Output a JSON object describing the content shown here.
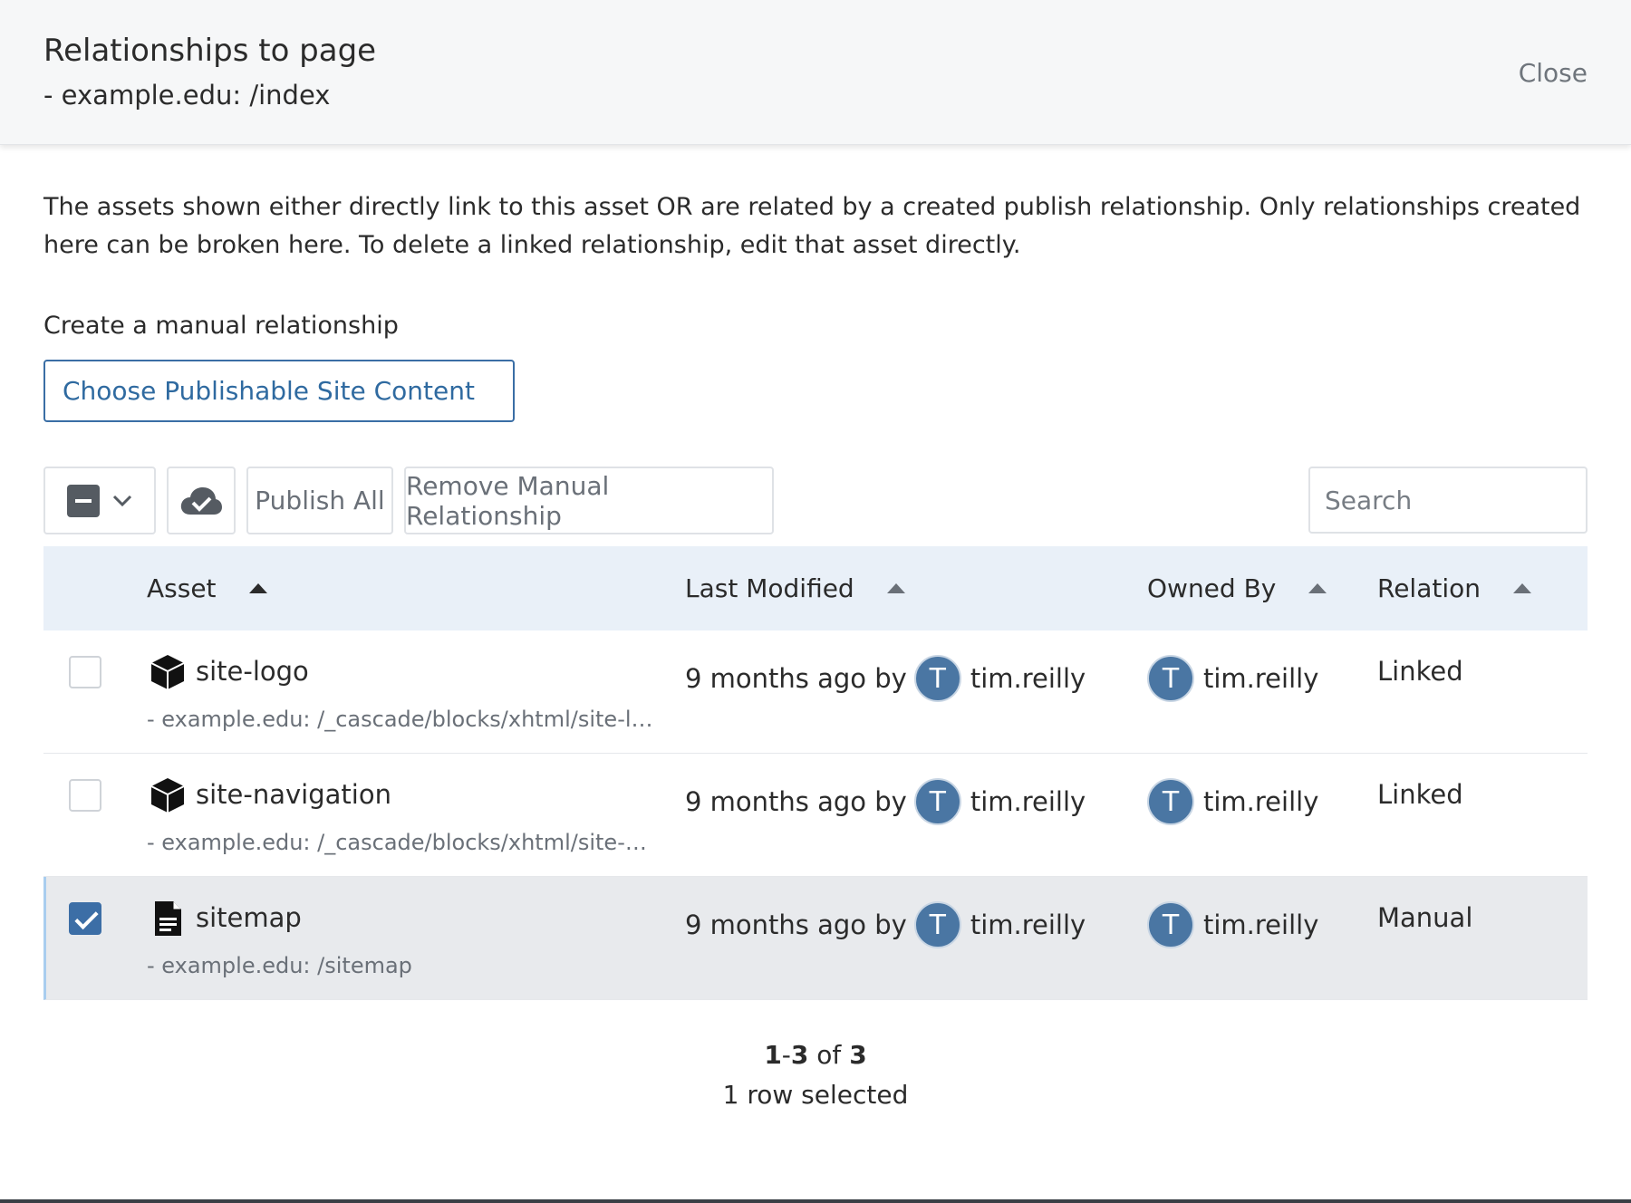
{
  "header": {
    "title": "Relationships to page",
    "subtitle": "- example.edu: /index",
    "close_label": "Close"
  },
  "description": "The assets shown either directly link to this asset OR are related by a created publish relationship. Only relationships created here can be broken here. To delete a linked relationship, edit that asset directly.",
  "manual": {
    "label": "Create a manual relationship",
    "choose_button": "Choose Publishable Site Content"
  },
  "toolbar": {
    "publish_all": "Publish All",
    "remove_manual": "Remove Manual Relationship",
    "search_placeholder": "Search",
    "icons": [
      "minus-checkbox-icon",
      "chevron-down-icon",
      "cloud-check-icon"
    ]
  },
  "table": {
    "columns": [
      "Asset",
      "Last Modified",
      "Owned By",
      "Relation"
    ],
    "rows": [
      {
        "icon": "block-cube-icon",
        "name": "site-logo",
        "path": "- example.edu: /_cascade/blocks/xhtml/site-logo",
        "modified": "9 months ago by",
        "modified_user_initial": "T",
        "modified_user": "tim.reilly",
        "owner_initial": "T",
        "owner": "tim.reilly",
        "relation": "Linked",
        "checked": false
      },
      {
        "icon": "block-cube-icon",
        "name": "site-navigation",
        "path": "- example.edu: /_cascade/blocks/xhtml/site-na...",
        "modified": "9 months ago by",
        "modified_user_initial": "T",
        "modified_user": "tim.reilly",
        "owner_initial": "T",
        "owner": "tim.reilly",
        "relation": "Linked",
        "checked": false
      },
      {
        "icon": "page-document-icon",
        "name": "sitemap",
        "path": "- example.edu: /sitemap",
        "modified": "9 months ago by",
        "modified_user_initial": "T",
        "modified_user": "tim.reilly",
        "owner_initial": "T",
        "owner": "tim.reilly",
        "relation": "Manual",
        "checked": true
      }
    ]
  },
  "pager": {
    "range_start": "1",
    "range_end": "3",
    "of_word": "of",
    "total": "3",
    "selected_text": "1 row selected"
  },
  "colors": {
    "accent": "#3c6ea6",
    "header_bg": "#f6f7f8",
    "table_header_bg": "#e9f0f8",
    "selected_row_bg": "#e8eaed"
  }
}
